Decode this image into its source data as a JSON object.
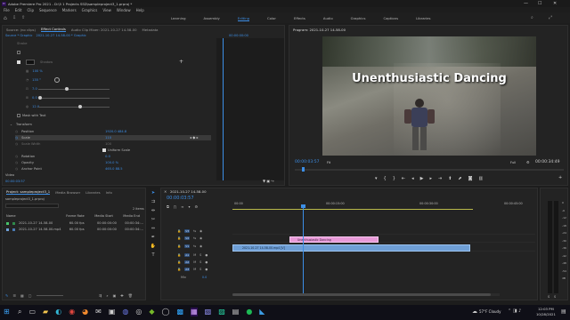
{
  "titlebar": {
    "title": "Adobe Premiere Pro 2021 - D:\\5 1 Projects SSD\\sampleproject3_1.prproj *",
    "minimize": "—",
    "maximize": "☐",
    "close": "✕"
  },
  "menubar": [
    "File",
    "Edit",
    "Clip",
    "Sequence",
    "Markers",
    "Graphics",
    "View",
    "Window",
    "Help"
  ],
  "workspaces": {
    "items": [
      "Learning",
      "Assembly",
      "Editing",
      "Color",
      "Effects",
      "Audio",
      "Graphics",
      "Captions",
      "Libraries"
    ],
    "active": "Editing"
  },
  "source_panel": {
    "tabs": [
      "Source: (no clips)",
      "Effect Controls",
      "Audio Clip Mixer: 2021-10-27 14-58-00",
      "Metadata"
    ],
    "active_tab": "Effect Controls",
    "clip_breadcrumb": "Source * Graphic",
    "clip_breadcrumb2": "2021-10-27 14-58-00 * Graphic",
    "time_readout": "00:00:00:00",
    "rows": [
      {
        "label": "Stroke",
        "value": ""
      },
      {
        "label": "Shadow",
        "value": ""
      },
      {
        "label": "",
        "value": "100 %"
      },
      {
        "label": "",
        "value": "135 °"
      },
      {
        "label": "",
        "value": "7.0"
      },
      {
        "label": "",
        "value": "0.0"
      },
      {
        "label": "",
        "value": "12.0"
      },
      {
        "label": "Mask with Text",
        "value": ""
      },
      {
        "label": "Transform",
        "value": ""
      },
      {
        "label": "Position",
        "value": "1920.0   484.8"
      },
      {
        "label": "Scale",
        "value": "110"
      },
      {
        "label": "Scale Width",
        "value": "100"
      },
      {
        "label": "",
        "value": "Uniform Scale"
      },
      {
        "label": "Rotation",
        "value": "0.0"
      },
      {
        "label": "Opacity",
        "value": "100.0 %"
      },
      {
        "label": "Anchor Point",
        "value": "465.0   88.5"
      }
    ],
    "bottom_time": "00:00:03:57",
    "video_label": "Video"
  },
  "program_monitor": {
    "title": "Program: 2021-10-27 14-58-00",
    "overlay_text": "Unenthusiastic Dancing",
    "timecode": "00:00:03:57",
    "fit": "Fit",
    "quality": "Full",
    "duration": "00:00:34:49"
  },
  "project_panel": {
    "tabs": [
      "Project: sampleproject3_1",
      "Media Browser",
      "Libraries",
      "Info"
    ],
    "active_tab": "Project: sampleproject3_1",
    "project_file": "sampleproject3_1.prproj",
    "item_count": "2 items",
    "columns": [
      "Name",
      "Frame Rate",
      "Media Start",
      "Media End"
    ],
    "items": [
      {
        "name": "2021-10-27 14-58-00",
        "frame_rate": "60.00 fps",
        "media_start": "00:00:00:00",
        "media_end": "00:00:34:..."
      },
      {
        "name": "2021-10-27 14-58-00.mp4",
        "frame_rate": "60.00 fps",
        "media_start": "00:00:00:00",
        "media_end": "00:00:34:..."
      }
    ]
  },
  "timeline": {
    "tab": "2021-10-27 14-58-00",
    "timecode": "00:00:03:57",
    "ruler": [
      "00:00",
      "00:00:15:00",
      "00:00:30:00",
      "00:00:45:00"
    ],
    "tracks": [
      {
        "name": "V3",
        "label": "V3"
      },
      {
        "name": "V2",
        "label": "V2"
      },
      {
        "name": "V1",
        "label": "V1"
      },
      {
        "name": "A1",
        "label": "A1"
      },
      {
        "name": "A2",
        "label": "A2"
      },
      {
        "name": "A3",
        "label": "A3"
      },
      {
        "name": "Mix",
        "label": "Mix"
      }
    ],
    "mix_value": "0.0",
    "graphic_clip": "Unenthusiastic Dancing",
    "video_clip": "2021-10-27 14-58-00.mp4 [V]",
    "audio_meter_labels": [
      "0",
      "-6",
      "-12",
      "-18",
      "-24",
      "-30",
      "-36",
      "-42",
      "-48",
      "-54",
      "dB"
    ]
  },
  "taskbar": {
    "weather": "57°F  Cloudy",
    "time": "12:03 PM",
    "date": "10/28/2021"
  },
  "colors": {
    "accent": "#3c8ee6",
    "graphic_clip": "#e89ad8",
    "video_clip": "#6f9fd6",
    "playhead": "#3c8ee6"
  }
}
